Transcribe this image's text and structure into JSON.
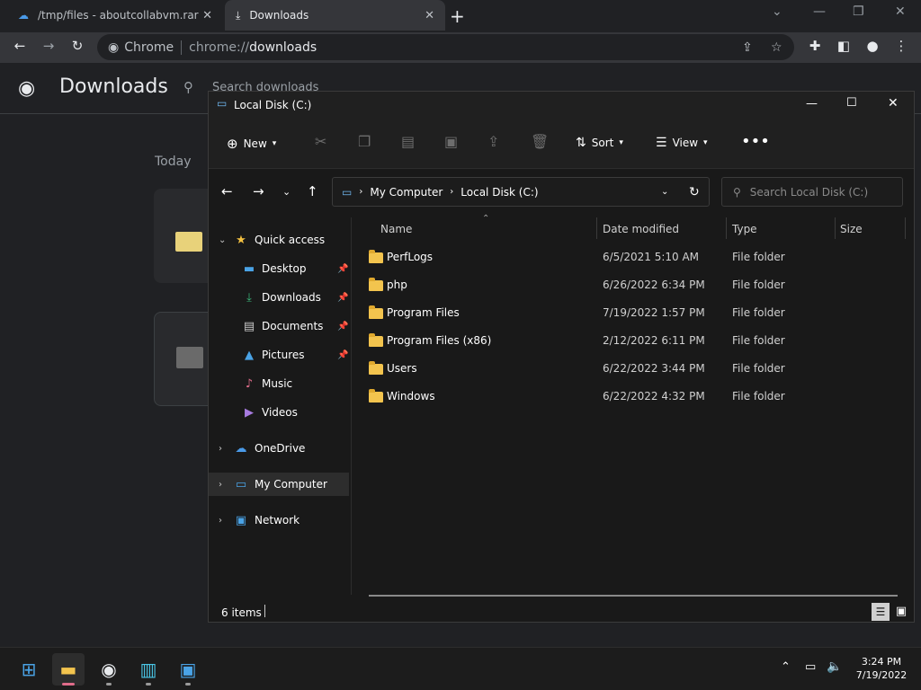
{
  "browser": {
    "tabs": [
      {
        "title": "/tmp/files - aboutcollabvm.rar"
      },
      {
        "title": "Downloads"
      }
    ],
    "omnibox": {
      "chip": "Chrome",
      "scheme": "chrome://",
      "host": "downloads"
    }
  },
  "downloads_page": {
    "title": "Downloads",
    "search_placeholder": "Search downloads",
    "section": "Today"
  },
  "explorer": {
    "title": "Local Disk (C:)",
    "commands": {
      "new": "New",
      "sort": "Sort",
      "view": "View"
    },
    "breadcrumb": [
      "My Computer",
      "Local Disk (C:)"
    ],
    "search_placeholder": "Search Local Disk (C:)",
    "nav": {
      "quick_access": "Quick access",
      "items": [
        {
          "label": "Desktop",
          "pinned": true
        },
        {
          "label": "Downloads",
          "pinned": true
        },
        {
          "label": "Documents",
          "pinned": true
        },
        {
          "label": "Pictures",
          "pinned": true
        },
        {
          "label": "Music",
          "pinned": false
        },
        {
          "label": "Videos",
          "pinned": false
        }
      ],
      "onedrive": "OneDrive",
      "my_computer": "My Computer",
      "network": "Network"
    },
    "columns": [
      "Name",
      "Date modified",
      "Type",
      "Size"
    ],
    "rows": [
      {
        "name": "PerfLogs",
        "date": "6/5/2021 5:10 AM",
        "type": "File folder"
      },
      {
        "name": "php",
        "date": "6/26/2022 6:34 PM",
        "type": "File folder"
      },
      {
        "name": "Program Files",
        "date": "7/19/2022 1:57 PM",
        "type": "File folder"
      },
      {
        "name": "Program Files (x86)",
        "date": "2/12/2022 6:11 PM",
        "type": "File folder"
      },
      {
        "name": "Users",
        "date": "6/22/2022 3:44 PM",
        "type": "File folder"
      },
      {
        "name": "Windows",
        "date": "6/22/2022 4:32 PM",
        "type": "File folder"
      }
    ],
    "status": "6 items"
  },
  "taskbar": {
    "time": "3:24 PM",
    "date": "7/19/2022"
  }
}
